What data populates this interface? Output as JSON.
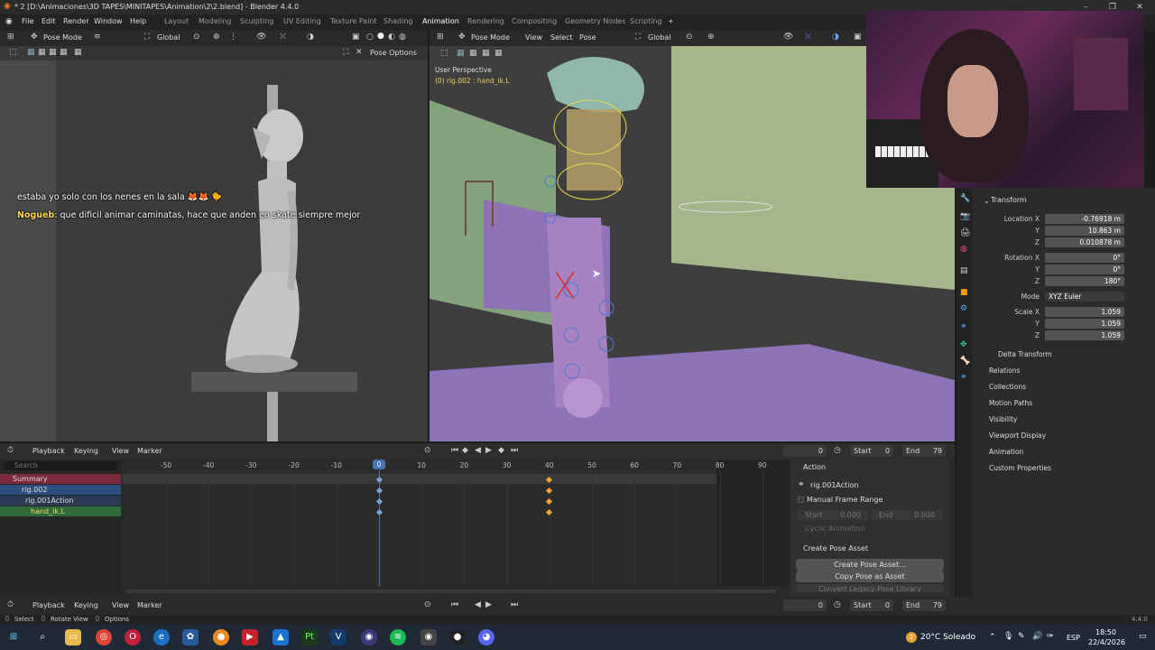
{
  "window": {
    "title": "* 2 [D:\\Animaciones\\3D TAPES\\MINITAPES\\Animation\\2\\2.blend] - Blender 4.4.0",
    "minimize": "–",
    "maximize": "❐",
    "close": "✕"
  },
  "menu": [
    "File",
    "Edit",
    "Render",
    "Window",
    "Help"
  ],
  "workspaces": [
    "Layout",
    "Modeling",
    "Sculpting",
    "UV Editing",
    "Texture Paint",
    "Shading",
    "Animation",
    "Rendering",
    "Compositing",
    "Geometry Nodes",
    "Scripting",
    "+"
  ],
  "left_header": {
    "mode": "Pose Mode",
    "orientation": "Global",
    "pose_options": "Pose Options"
  },
  "right_header": {
    "mode": "Pose Mode",
    "menus": [
      "View",
      "Select",
      "Pose"
    ],
    "orientation": "Global"
  },
  "viewport": {
    "perspective": "User Perspective",
    "object": "(0) rig.002 : hand_ik.L"
  },
  "chat": [
    {
      "user": "",
      "text": "estaba yo solo con los nenes en la sala 🦊🦊 🐤"
    },
    {
      "user": "Nogueb",
      "text": ": que dificil animar caminatas, hace que anden en skate siempre mejor"
    }
  ],
  "properties": {
    "section": "Transform",
    "location": {
      "label": "Location X",
      "x": "-0.76918 m",
      "y": "10.863 m",
      "z": "0.010878 m"
    },
    "rotation": {
      "label": "Rotation X",
      "x": "0°",
      "y": "0°",
      "z": "180°"
    },
    "mode": {
      "label": "Mode",
      "value": "XYZ Euler"
    },
    "scale": {
      "label": "Scale X",
      "x": "1.059",
      "y": "1.059",
      "z": "1.059"
    },
    "axis": {
      "y": "Y",
      "z": "Z"
    },
    "subsections": [
      "Delta Transform",
      "Relations",
      "Collections",
      "Motion Paths",
      "Visibility",
      "Viewport Display",
      "Animation",
      "Custom Properties"
    ]
  },
  "timeline": {
    "menus": [
      "Playback",
      "Keying",
      "View",
      "Marker"
    ],
    "current_frame": "0",
    "start_label": "Start",
    "start": "0",
    "end_label": "End",
    "end": "79",
    "ruler": [
      "-50",
      "-40",
      "-30",
      "-20",
      "-10",
      "0",
      "10",
      "20",
      "30",
      "40",
      "50",
      "60",
      "70",
      "80",
      "90"
    ],
    "playhead": 0,
    "keyframes": [
      0,
      40
    ],
    "channels": [
      "Summary",
      "rig.002",
      "rig.001Action",
      "hand_ik.L"
    ],
    "search_placeholder": "Search"
  },
  "action_panel": {
    "title": "Action",
    "action": "rig.001Action",
    "manual": "Manual Frame Range",
    "start_label": "Start",
    "start": "0.000",
    "end_label": "End",
    "end": "0.000",
    "cyclic": "Cyclic Animation",
    "pose_asset_title": "Create Pose Asset",
    "create_btn": "Create Pose Asset...",
    "copy_btn": "Copy Pose as Asset",
    "convert_btn": "Convert Legacy Pose Library"
  },
  "bottom": {
    "menus": [
      "Playback",
      "Keying",
      "View",
      "Marker"
    ],
    "frame": "0",
    "start_label": "Start",
    "start": "0",
    "end_label": "End",
    "end": "79"
  },
  "status": {
    "select": "Select",
    "rotate": "Rotate View",
    "options": "Options",
    "version": "4.4.0"
  },
  "taskbar": {
    "weather": "20°C Soleado",
    "lang": "ESP",
    "time": "18:50",
    "date": "22/4/2026",
    "badge": "2"
  },
  "colors": {
    "accent": "#4772b3",
    "keyframe": "#f0a830",
    "selected_bone": "#3a8a3a"
  }
}
